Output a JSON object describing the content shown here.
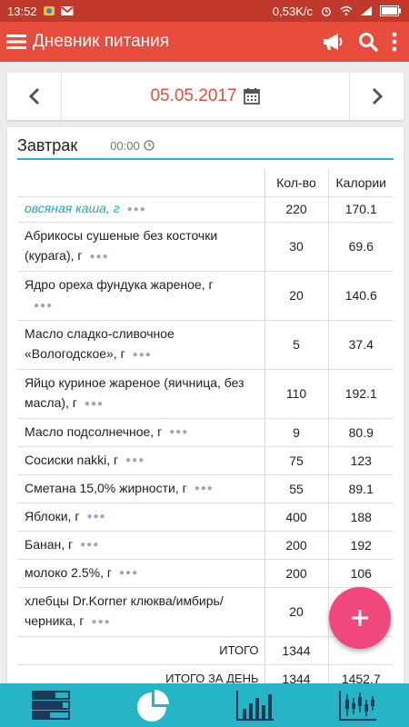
{
  "status_bar": {
    "time": "13:52",
    "speed": "0,53K/c"
  },
  "app_bar": {
    "title": "Дневник питания",
    "icons": [
      "menu-icon",
      "megaphone-icon",
      "search-icon",
      "more-vert-icon"
    ]
  },
  "date_bar": {
    "date": "05.05.2017"
  },
  "meal": {
    "name": "Завтрак",
    "time": "00:00"
  },
  "table": {
    "headers": {
      "name": "",
      "qty": "Кол-во",
      "cal": "Калории"
    },
    "rows": [
      {
        "name": "овсяная каша, г",
        "qty": "220",
        "cal": "170.1"
      },
      {
        "name": "Абрикосы сушеные без косточки (курага), г",
        "qty": "30",
        "cal": "69.6"
      },
      {
        "name": "Ядро ореха фундука жареное, г",
        "qty": "20",
        "cal": "140.6"
      },
      {
        "name": "Масло сладко-сливочное «Вологодское», г",
        "qty": "5",
        "cal": "37.4"
      },
      {
        "name": "Яйцо куриное жареное (яичница, без масла), г",
        "qty": "110",
        "cal": "192.1"
      },
      {
        "name": "Масло подсолнечное, г",
        "qty": "9",
        "cal": "80.9"
      },
      {
        "name": "Сосиски nakki, г",
        "qty": "75",
        "cal": "123"
      },
      {
        "name": "Сметана 15,0% жирности, г",
        "qty": "55",
        "cal": "89.1"
      },
      {
        "name": "Яблоки, г",
        "qty": "400",
        "cal": "188"
      },
      {
        "name": "Банан, г",
        "qty": "200",
        "cal": "192"
      },
      {
        "name": "молоко 2.5%, г",
        "qty": "200",
        "cal": "106"
      },
      {
        "name": "хлебцы Dr.Korner клюква/имбирь/черника, г",
        "qty": "20",
        "cal": ""
      }
    ],
    "total": {
      "label": "ИТОГО",
      "qty": "1344",
      "cal": ""
    },
    "day_total": {
      "label": "ИТОГО ЗА ДЕНЬ",
      "qty": "1344",
      "cal": "1452.7"
    }
  },
  "fab": {
    "label": "+"
  },
  "bottom_nav": {
    "items": [
      "diary-list-icon",
      "pie-chart-icon",
      "bar-chart-icon",
      "stock-chart-icon"
    ]
  },
  "colors": {
    "app_bar": "#e74c3c",
    "status_bar": "#c0392b",
    "accent": "#26b5c6",
    "fab": "#f0477c"
  }
}
